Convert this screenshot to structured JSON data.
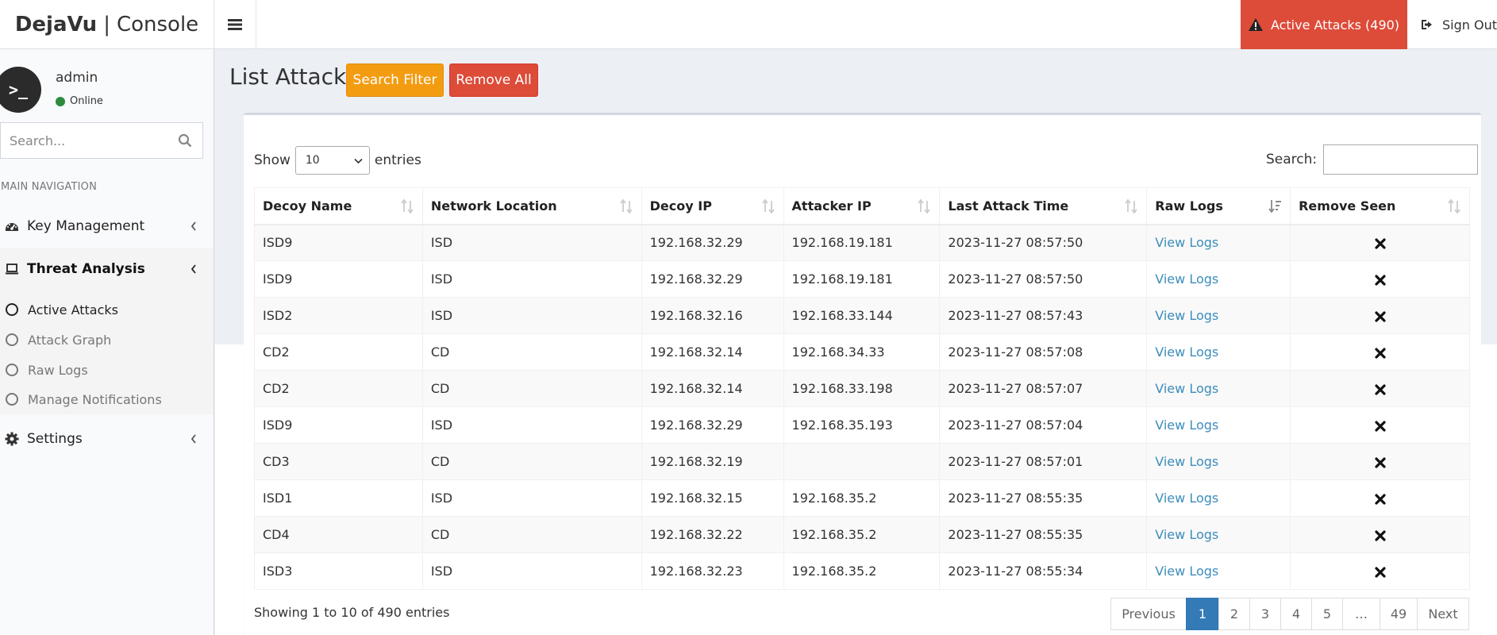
{
  "header": {
    "brand_bold": "DejaVu",
    "brand_sep": "|",
    "brand_rest": "Console",
    "alerts_label": "Active Attacks (490)",
    "signout_label": "Sign Out"
  },
  "user": {
    "avatar_text": ">_",
    "name": "admin",
    "status": "Online",
    "status_color": "#2e8b3d"
  },
  "sidebar": {
    "search_placeholder": "Search...",
    "nav_header": "MAIN NAVIGATION",
    "items": [
      {
        "label": "Key Management",
        "icon": "tachometer-icon"
      },
      {
        "label": "Threat Analysis",
        "icon": "laptop-icon"
      },
      {
        "label": "Settings",
        "icon": "gear-icon"
      }
    ],
    "subitems": [
      {
        "label": "Active Attacks"
      },
      {
        "label": "Attack Graph"
      },
      {
        "label": "Raw Logs"
      },
      {
        "label": "Manage Notifications"
      }
    ]
  },
  "page": {
    "title": "List Attacks",
    "search_filter_label": "Search Filter",
    "remove_all_label": "Remove All"
  },
  "table_controls": {
    "show_label": "Show",
    "entries_value": "10",
    "entries_label": "entries",
    "search_label": "Search:",
    "search_value": ""
  },
  "table": {
    "columns": [
      "Decoy Name",
      "Network Location",
      "Decoy IP",
      "Attacker IP",
      "Last Attack Time",
      "Raw Logs",
      "Remove Seen"
    ],
    "rows": [
      [
        "ISD9",
        "ISD",
        "192.168.32.29",
        "192.168.19.181",
        "2023-11-27 08:57:50",
        "View Logs"
      ],
      [
        "ISD9",
        "ISD",
        "192.168.32.29",
        "192.168.19.181",
        "2023-11-27 08:57:50",
        "View Logs"
      ],
      [
        "ISD2",
        "ISD",
        "192.168.32.16",
        "192.168.33.144",
        "2023-11-27 08:57:43",
        "View Logs"
      ],
      [
        "CD2",
        "CD",
        "192.168.32.14",
        "192.168.34.33",
        "2023-11-27 08:57:08",
        "View Logs"
      ],
      [
        "CD2",
        "CD",
        "192.168.32.14",
        "192.168.33.198",
        "2023-11-27 08:57:07",
        "View Logs"
      ],
      [
        "ISD9",
        "ISD",
        "192.168.32.29",
        "192.168.35.193",
        "2023-11-27 08:57:04",
        "View Logs"
      ],
      [
        "CD3",
        "CD",
        "192.168.32.19",
        "",
        "2023-11-27 08:57:01",
        "View Logs"
      ],
      [
        "ISD1",
        "ISD",
        "192.168.32.15",
        "192.168.35.2",
        "2023-11-27 08:55:35",
        "View Logs"
      ],
      [
        "CD4",
        "CD",
        "192.168.32.22",
        "192.168.35.2",
        "2023-11-27 08:55:35",
        "View Logs"
      ],
      [
        "ISD3",
        "ISD",
        "192.168.32.23",
        "192.168.35.2",
        "2023-11-27 08:55:34",
        "View Logs"
      ]
    ]
  },
  "footer": {
    "info": "Showing 1 to 10 of 490 entries",
    "pages": [
      "Previous",
      "1",
      "2",
      "3",
      "4",
      "5",
      "…",
      "49",
      "Next"
    ],
    "current_page": "1"
  },
  "colors": {
    "danger": "#dd4b39",
    "warning": "#f39c12",
    "link": "#3c8dbc",
    "pager_active": "#337ab7"
  }
}
